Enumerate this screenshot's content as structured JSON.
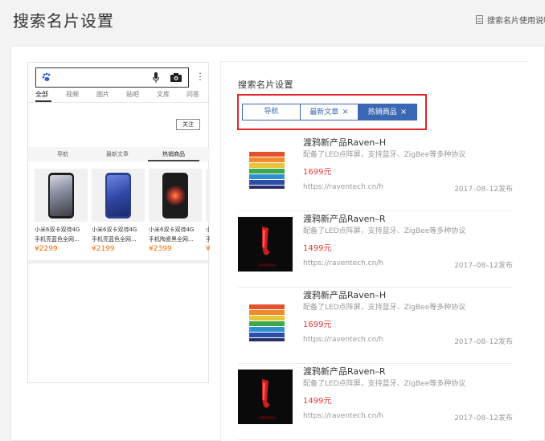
{
  "header": {
    "title": "搜索名片设置",
    "help_link": "搜索名片使用说明"
  },
  "preview": {
    "search_tabs": [
      "全部",
      "视频",
      "图片",
      "贴吧",
      "文库",
      "问答"
    ],
    "follow_label": "关注",
    "card_tabs": [
      "导航",
      "最新文章",
      "热销商品"
    ],
    "products": [
      {
        "name": "小米6双卡双待4G",
        "sub": "手机亮蓝色全网...",
        "price": "¥2299"
      },
      {
        "name": "小米6双卡双待4G",
        "sub": "手机亮蓝色全网...",
        "price": "¥2199"
      },
      {
        "name": "小米6双卡双待4G",
        "sub": "手机陶瓷黑全网...",
        "price": "¥2399"
      },
      {
        "name": "小",
        "sub": "手",
        "price": "¥"
      }
    ]
  },
  "settings": {
    "title": "搜索名片设置",
    "tags": [
      "导航",
      "最新文章",
      "热销商品"
    ],
    "close_glyph": "×",
    "feed": [
      {
        "title": "渡鸦新产品Raven–H",
        "desc": "配备了LED点阵屏，支持蓝牙、ZigBee等多种协议",
        "price": "1699元",
        "url": "https://raventech.cn/h",
        "date": "2017–08–12发布"
      },
      {
        "title": "渡鸦新产品Raven–R",
        "desc": "配备了LED点阵屏，支持蓝牙、ZigBee等多种协议",
        "price": "1499元",
        "url": "https://raventech.cn/h",
        "date": "2017–08–12发布"
      },
      {
        "title": "渡鸦新产品Raven–H",
        "desc": "配备了LED点阵屏，支持蓝牙、ZigBee等多种协议",
        "price": "1699元",
        "url": "https://raventech.cn/h",
        "date": "2017–08–12发布"
      },
      {
        "title": "渡鸦新产品Raven–R",
        "desc": "配备了LED点阵屏，支持蓝牙、ZigBee等多种协议",
        "price": "1499元",
        "url": "https://raventech.cn/h",
        "date": "2017–08–12发布"
      }
    ]
  },
  "colors": {
    "accent_blue": "#3a68b4",
    "highlight_red": "#e3262d",
    "price_orange": "#ff6a00",
    "price_red": "#e4393c"
  }
}
